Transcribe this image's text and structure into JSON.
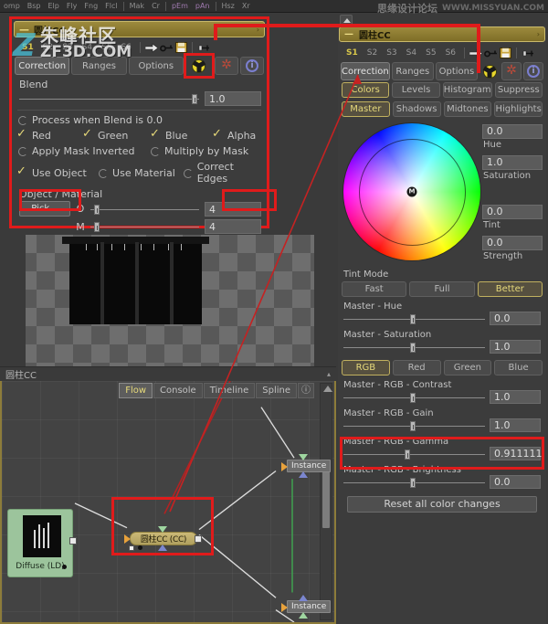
{
  "watermarks": {
    "top_cn": "思缘设计论坛",
    "top_url": "WWW.MISSYUAN.COM",
    "left_cn": "朱峰社区",
    "left_en": "ZF3D.COM",
    "left_logo": "Z"
  },
  "top_menu": {
    "items": [
      "omp",
      "Bsp",
      "Elp",
      "Fly",
      "Fng",
      "Flcl",
      "Mak",
      "Cr",
      "pEm",
      "pAn",
      "Hsz",
      "Xr"
    ],
    "highlight_indices": [
      8,
      9
    ]
  },
  "inspector": {
    "title": "圆柱CC",
    "collapse_icon": "minus-icon",
    "states": [
      "S1",
      "S2",
      "S3",
      "S4",
      "S5",
      "S6"
    ],
    "active_state": "S1",
    "toolbar_icons": [
      "arrow-right-icon",
      "key-icon",
      "save-icon",
      "pin-icon"
    ],
    "tabs": [
      "Correction",
      "Ranges",
      "Options"
    ],
    "active_tab": "Correction",
    "radioactive_icon": "radioactive-icon",
    "gear_icon": "gear-icon",
    "info_icon": "info-icon",
    "blend": {
      "label": "Blend",
      "value": "1.0",
      "slider_pct": 97
    },
    "process_when_blend": {
      "label": "Process when Blend is 0.0",
      "checked": false
    },
    "channels": [
      {
        "label": "Red",
        "checked": true
      },
      {
        "label": "Green",
        "checked": true
      },
      {
        "label": "Blue",
        "checked": true
      },
      {
        "label": "Alpha",
        "checked": true
      }
    ],
    "mask_options": [
      {
        "label": "Apply Mask Inverted",
        "checked": false
      },
      {
        "label": "Multiply by Mask",
        "checked": false
      }
    ],
    "object_options": [
      {
        "label": "Use Object",
        "checked": true
      },
      {
        "label": "Use Material",
        "checked": false
      },
      {
        "label": "Correct Edges",
        "checked": false
      }
    ],
    "object_material": {
      "section_label": "Object / Material",
      "pick_button": "Pick...",
      "rows": [
        {
          "label": "O",
          "value": "4",
          "slider_pct": 4
        },
        {
          "label": "M",
          "value": "4",
          "slider_pct": 4
        }
      ]
    }
  },
  "viewport": {
    "footer_label": "圆柱CC",
    "caret_icon": "caret-up-icon"
  },
  "flow": {
    "tabs": [
      "Flow",
      "Console",
      "Timeline",
      "Spline"
    ],
    "active_tab": "Flow",
    "info_icon": "info-icon",
    "nodes": [
      {
        "name": "Diffuse  (LD)",
        "type": "diffuse"
      },
      {
        "name": "圆柱CC  (CC)",
        "type": "colorcorrect"
      },
      {
        "name": "Instance",
        "type": "instance"
      },
      {
        "name": "Instance",
        "type": "instance"
      }
    ]
  },
  "colorcorrector": {
    "title": "圆柱CC",
    "states": [
      "S1",
      "S2",
      "S3",
      "S4",
      "S5",
      "S6"
    ],
    "active_state": "S1",
    "toolbar_icons": [
      "arrow-right-icon",
      "key-icon",
      "save-icon",
      "pin-icon"
    ],
    "tabs": [
      "Correction",
      "Ranges",
      "Options"
    ],
    "active_tab": "Correction",
    "radioactive_icon": "radioactive-icon",
    "gear_icon": "gear-icon",
    "info_icon": "info-icon",
    "mode_tabs": [
      "Colors",
      "Levels",
      "Histogram",
      "Suppress"
    ],
    "active_mode": "Colors",
    "range_tabs": [
      "Master",
      "Shadows",
      "Midtones",
      "Highlights"
    ],
    "active_range": "Master",
    "wheel": {
      "handle_label": "M",
      "values": [
        {
          "label": "Hue",
          "value": "0.0"
        },
        {
          "label": "Saturation",
          "value": "1.0"
        },
        {
          "label": "Tint",
          "value": "0.0"
        },
        {
          "label": "Strength",
          "value": "0.0"
        }
      ]
    },
    "tint_mode": {
      "label": "Tint Mode",
      "options": [
        "Fast",
        "Full",
        "Better"
      ],
      "selected": "Better"
    },
    "master_sliders": [
      {
        "label": "Master - Hue",
        "value": "0.0",
        "slider_pct": 48
      },
      {
        "label": "Master - Saturation",
        "value": "1.0",
        "slider_pct": 48
      }
    ],
    "channel_tabs": [
      "RGB",
      "Red",
      "Green",
      "Blue"
    ],
    "active_channel": "RGB",
    "rgb_sliders": [
      {
        "label": "Master - RGB - Contrast",
        "value": "1.0",
        "slider_pct": 48,
        "highlighted": false
      },
      {
        "label": "Master - RGB - Gain",
        "value": "1.0",
        "slider_pct": 48,
        "highlighted": false
      },
      {
        "label": "Master - RGB - Gamma",
        "value": "0.911111",
        "slider_pct": 44,
        "highlighted": true
      },
      {
        "label": "Master - RGB - Brightness",
        "value": "0.0",
        "slider_pct": 48,
        "highlighted": false
      }
    ],
    "reset_button": "Reset all color changes"
  },
  "colors": {
    "accent_gold": "#9c8a3d",
    "highlight_red": "#e01b1b",
    "panel_bg": "#3c3c3c",
    "text": "#c8c8c8",
    "selected_text": "#e6d97a"
  }
}
